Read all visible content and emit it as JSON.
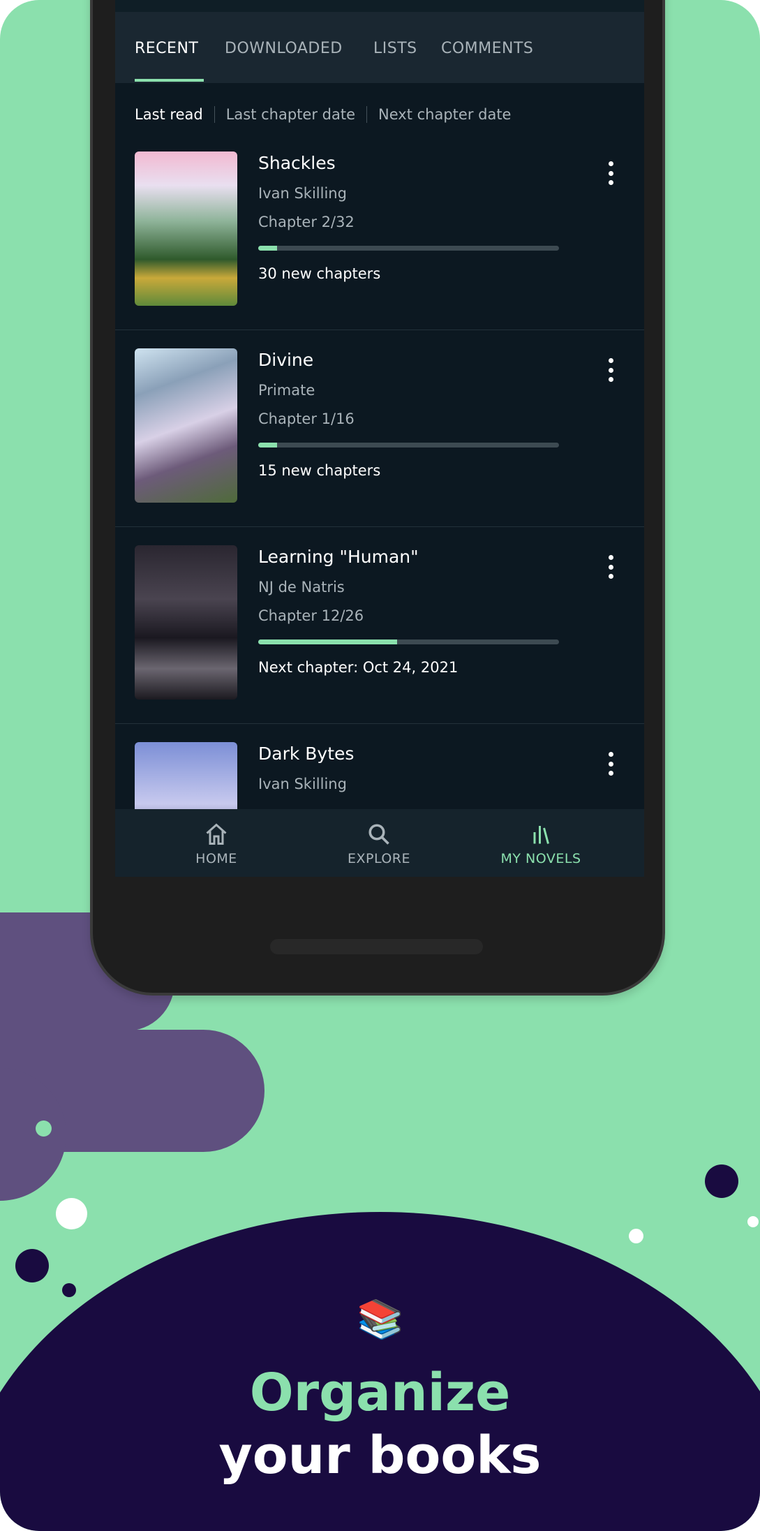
{
  "tabs": [
    {
      "label": "RECENT",
      "active": true
    },
    {
      "label": "DOWNLOADED"
    },
    {
      "label": "LISTS"
    },
    {
      "label": "COMMENTS"
    }
  ],
  "sort": [
    "Last read",
    "Last chapter date",
    "Next chapter date"
  ],
  "novels": [
    {
      "title": "Shackles",
      "author": "Ivan Skilling",
      "chapter": "Chapter 2/32",
      "progress": 0.0625,
      "extra": "30 new chapters"
    },
    {
      "title": "Divine",
      "author": "Primate",
      "chapter": "Chapter 1/16",
      "progress": 0.0625,
      "extra": "15 new chapters"
    },
    {
      "title": "Learning \"Human\"",
      "author": "NJ de Natris",
      "chapter": "Chapter 12/26",
      "progress": 0.4615,
      "extra": "Next chapter: Oct 24, 2021"
    },
    {
      "title": "Dark Bytes",
      "author": "Ivan Skilling"
    }
  ],
  "nav": [
    {
      "label": "HOME",
      "icon": "home-icon"
    },
    {
      "label": "EXPLORE",
      "icon": "search-icon"
    },
    {
      "label": "MY NOVELS",
      "icon": "library-icon",
      "active": true
    }
  ],
  "promo": {
    "emoji": "📚",
    "line1": "Organize",
    "line2": "your books"
  },
  "colors": {
    "background": "#8be0ad",
    "accent": "#8be0ad",
    "blob": "#5f507f",
    "ellipse": "#190b40",
    "screen": "#0c1821"
  }
}
